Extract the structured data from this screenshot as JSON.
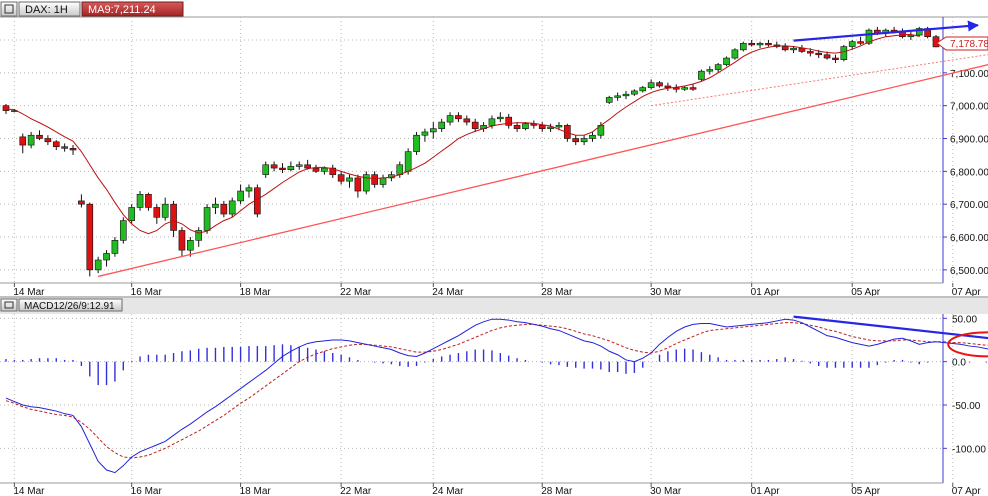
{
  "chart_data": [
    {
      "type": "candlestick",
      "instrument": "DAX",
      "timeframe": "1H",
      "header_symbol": "DAX: 1H",
      "header_indicator": "MA9:7,211.24",
      "last_price_label": "7,178.78",
      "y_ticks": [
        "7,200.00",
        "7,100.00",
        "7,000.00",
        "6,900.00",
        "6,800.00",
        "6,700.00",
        "6,600.00",
        "6,500.00"
      ],
      "y_tick_values": [
        7200,
        7100,
        7000,
        6900,
        6800,
        6700,
        6600,
        6500
      ],
      "ylim": [
        6460,
        7270
      ],
      "x_tick_labels": [
        "14 Mar",
        "16 Mar",
        "18 Mar",
        "22 Mar",
        "24 Mar",
        "28 Mar",
        "30 Mar",
        "01 Apr",
        "05 Apr",
        "07 Apr"
      ],
      "x_tick_index": [
        1,
        15,
        28,
        40,
        51,
        64,
        77,
        89,
        101,
        113
      ],
      "ma_period": 9,
      "candles": [
        [
          7000,
          7005,
          6975,
          6985
        ],
        [
          6985,
          6990,
          6980,
          6985
        ],
        [
          6905,
          6915,
          6855,
          6880
        ],
        [
          6880,
          6920,
          6870,
          6910
        ],
        [
          6910,
          6925,
          6895,
          6900
        ],
        [
          6900,
          6910,
          6880,
          6890
        ],
        [
          6890,
          6895,
          6865,
          6875
        ],
        [
          6875,
          6885,
          6860,
          6870
        ],
        [
          6870,
          6880,
          6850,
          6865
        ],
        [
          6710,
          6730,
          6690,
          6700
        ],
        [
          6700,
          6705,
          6480,
          6500
        ],
        [
          6500,
          6540,
          6490,
          6530
        ],
        [
          6530,
          6560,
          6510,
          6550
        ],
        [
          6550,
          6600,
          6540,
          6590
        ],
        [
          6590,
          6660,
          6580,
          6650
        ],
        [
          6650,
          6700,
          6640,
          6690
        ],
        [
          6690,
          6740,
          6680,
          6730
        ],
        [
          6730,
          6735,
          6680,
          6690
        ],
        [
          6690,
          6700,
          6640,
          6660
        ],
        [
          6660,
          6720,
          6650,
          6700
        ],
        [
          6700,
          6710,
          6600,
          6620
        ],
        [
          6620,
          6630,
          6540,
          6560
        ],
        [
          6560,
          6600,
          6540,
          6590
        ],
        [
          6590,
          6630,
          6570,
          6620
        ],
        [
          6620,
          6700,
          6610,
          6690
        ],
        [
          6690,
          6720,
          6670,
          6700
        ],
        [
          6700,
          6710,
          6660,
          6670
        ],
        [
          6670,
          6720,
          6660,
          6710
        ],
        [
          6710,
          6760,
          6700,
          6740
        ],
        [
          6740,
          6760,
          6720,
          6750
        ],
        [
          6750,
          6760,
          6660,
          6670
        ],
        [
          6790,
          6830,
          6780,
          6820
        ],
        [
          6820,
          6830,
          6800,
          6810
        ],
        [
          6810,
          6825,
          6795,
          6805
        ],
        [
          6805,
          6830,
          6800,
          6815
        ],
        [
          6815,
          6830,
          6805,
          6820
        ],
        [
          6820,
          6835,
          6805,
          6810
        ],
        [
          6810,
          6820,
          6795,
          6800
        ],
        [
          6800,
          6815,
          6790,
          6810
        ],
        [
          6810,
          6820,
          6780,
          6790
        ],
        [
          6790,
          6800,
          6760,
          6770
        ],
        [
          6770,
          6790,
          6750,
          6780
        ],
        [
          6780,
          6790,
          6720,
          6740
        ],
        [
          6740,
          6800,
          6730,
          6790
        ],
        [
          6790,
          6800,
          6750,
          6760
        ],
        [
          6760,
          6790,
          6750,
          6780
        ],
        [
          6780,
          6800,
          6770,
          6790
        ],
        [
          6790,
          6830,
          6780,
          6820
        ],
        [
          6800,
          6870,
          6790,
          6860
        ],
        [
          6860,
          6920,
          6850,
          6910
        ],
        [
          6910,
          6930,
          6890,
          6920
        ],
        [
          6920,
          6950,
          6900,
          6930
        ],
        [
          6930,
          6960,
          6920,
          6950
        ],
        [
          6950,
          6980,
          6940,
          6970
        ],
        [
          6970,
          6980,
          6950,
          6960
        ],
        [
          6960,
          6970,
          6940,
          6950
        ],
        [
          6950,
          6960,
          6920,
          6930
        ],
        [
          6930,
          6950,
          6920,
          6940
        ],
        [
          6940,
          6970,
          6930,
          6960
        ],
        [
          6960,
          6980,
          6950,
          6965
        ],
        [
          6965,
          6975,
          6930,
          6940
        ],
        [
          6940,
          6950,
          6920,
          6930
        ],
        [
          6930,
          6950,
          6925,
          6945
        ],
        [
          6945,
          6955,
          6930,
          6940
        ],
        [
          6940,
          6950,
          6920,
          6930
        ],
        [
          6930,
          6945,
          6920,
          6935
        ],
        [
          6935,
          6950,
          6925,
          6940
        ],
        [
          6940,
          6945,
          6890,
          6900
        ],
        [
          6900,
          6910,
          6880,
          6890
        ],
        [
          6890,
          6910,
          6880,
          6900
        ],
        [
          6900,
          6920,
          6890,
          6910
        ],
        [
          6910,
          6950,
          6900,
          6940
        ],
        [
          7010,
          7030,
          7005,
          7025
        ],
        [
          7025,
          7040,
          7015,
          7030
        ],
        [
          7030,
          7045,
          7020,
          7035
        ],
        [
          7035,
          7050,
          7030,
          7045
        ],
        [
          7045,
          7060,
          7040,
          7055
        ],
        [
          7055,
          7080,
          7050,
          7070
        ],
        [
          7070,
          7075,
          7055,
          7060
        ],
        [
          7060,
          7070,
          7045,
          7055
        ],
        [
          7055,
          7065,
          7040,
          7050
        ],
        [
          7050,
          7060,
          7045,
          7055
        ],
        [
          7055,
          7065,
          7045,
          7050
        ],
        [
          7080,
          7110,
          7075,
          7105
        ],
        [
          7105,
          7120,
          7095,
          7110
        ],
        [
          7110,
          7130,
          7100,
          7125
        ],
        [
          7125,
          7150,
          7120,
          7145
        ],
        [
          7145,
          7175,
          7140,
          7170
        ],
        [
          7170,
          7195,
          7165,
          7190
        ],
        [
          7190,
          7200,
          7180,
          7185
        ],
        [
          7185,
          7195,
          7175,
          7190
        ],
        [
          7190,
          7200,
          7180,
          7185
        ],
        [
          7185,
          7195,
          7175,
          7180
        ],
        [
          7180,
          7190,
          7165,
          7170
        ],
        [
          7170,
          7180,
          7160,
          7175
        ],
        [
          7175,
          7185,
          7160,
          7165
        ],
        [
          7165,
          7175,
          7150,
          7160
        ],
        [
          7160,
          7170,
          7145,
          7155
        ],
        [
          7155,
          7165,
          7140,
          7145
        ],
        [
          7145,
          7155,
          7130,
          7140
        ],
        [
          7140,
          7185,
          7135,
          7180
        ],
        [
          7180,
          7200,
          7170,
          7195
        ],
        [
          7195,
          7210,
          7185,
          7190
        ],
        [
          7190,
          7235,
          7185,
          7230
        ],
        [
          7230,
          7240,
          7215,
          7220
        ],
        [
          7220,
          7235,
          7210,
          7230
        ],
        [
          7230,
          7240,
          7220,
          7225
        ],
        [
          7225,
          7235,
          7205,
          7210
        ],
        [
          7210,
          7225,
          7200,
          7215
        ],
        [
          7215,
          7240,
          7210,
          7235
        ],
        [
          7235,
          7240,
          7205,
          7210
        ],
        [
          7210,
          7215,
          7178,
          7179
        ]
      ],
      "ma_values": [
        6990,
        6988,
        6975,
        6960,
        6948,
        6935,
        6920,
        6905,
        6892,
        6860,
        6820,
        6780,
        6745,
        6705,
        6668,
        6640,
        6620,
        6610,
        6620,
        6640,
        6650,
        6640,
        6622,
        6612,
        6618,
        6635,
        6650,
        6660,
        6680,
        6700,
        6715,
        6730,
        6748,
        6766,
        6782,
        6798,
        6808,
        6812,
        6812,
        6808,
        6800,
        6792,
        6785,
        6780,
        6778,
        6780,
        6782,
        6790,
        6800,
        6812,
        6825,
        6843,
        6862,
        6880,
        6900,
        6912,
        6922,
        6930,
        6938,
        6943,
        6946,
        6948,
        6948,
        6946,
        6942,
        6938,
        6928,
        6918,
        6910,
        6910,
        6920,
        6940,
        6958,
        6978,
        6996,
        7012,
        7028,
        7040,
        7048,
        7053,
        7056,
        7060,
        7066,
        7074,
        7085,
        7100,
        7116,
        7132,
        7150,
        7163,
        7172,
        7178,
        7182,
        7182,
        7180,
        7176,
        7172,
        7166,
        7162,
        7160,
        7164,
        7172,
        7182,
        7194,
        7203,
        7210,
        7213,
        7216,
        7217,
        7211
      ],
      "annotations": {
        "support_trendline": {
          "from_index": 11,
          "from_value": 6480,
          "to_index": 123,
          "to_value": 7160
        },
        "lower_dotted_line": {
          "from_index": 77,
          "from_value": 7000,
          "to_index": 123,
          "to_value": 7178
        },
        "price_high_arrow": {
          "from_index": 94,
          "from_value": 7198,
          "to_index": 116,
          "to_value": 7245
        }
      }
    },
    {
      "type": "macd",
      "header_indicator": "MACD12/26/9:12.91",
      "y_ticks": [
        "50.00",
        "0.0",
        "-50.00",
        "-100.00"
      ],
      "y_tick_values": [
        50,
        0,
        -50,
        -100
      ],
      "ylim": [
        -140,
        55
      ],
      "x_tick_labels": [
        "14 Mar",
        "16 Mar",
        "18 Mar",
        "22 Mar",
        "24 Mar",
        "28 Mar",
        "30 Mar",
        "01 Apr",
        "05 Apr",
        "07 Apr"
      ],
      "macd_line": [
        -42,
        -46,
        -50,
        -52,
        -53,
        -55,
        -57,
        -60,
        -62,
        -75,
        -95,
        -115,
        -125,
        -128,
        -120,
        -110,
        -104,
        -100,
        -96,
        -92,
        -85,
        -78,
        -72,
        -65,
        -58,
        -52,
        -45,
        -38,
        -31,
        -24,
        -17,
        -10,
        -2,
        6,
        12,
        17,
        21,
        23,
        24,
        25,
        25,
        24,
        22,
        20,
        18,
        16,
        14,
        10,
        7,
        6,
        10,
        15,
        20,
        25,
        30,
        36,
        42,
        46,
        49,
        49,
        48,
        46,
        45,
        43,
        41,
        38,
        36,
        32,
        28,
        24,
        22,
        18,
        12,
        8,
        2,
        0,
        4,
        10,
        20,
        28,
        35,
        40,
        43,
        44,
        44,
        42,
        40,
        41,
        42,
        43,
        44,
        45,
        47,
        49,
        48,
        45,
        40,
        35,
        30,
        28,
        25,
        22,
        20,
        18,
        20,
        23,
        26,
        27,
        24,
        20,
        22,
        23,
        22,
        21,
        20,
        18,
        17,
        15,
        13,
        12.9
      ],
      "signal_line": [
        -45,
        -48,
        -52,
        -55,
        -57,
        -59,
        -61,
        -62,
        -64,
        -70,
        -78,
        -88,
        -98,
        -105,
        -110,
        -111,
        -110,
        -108,
        -104,
        -100,
        -95,
        -90,
        -85,
        -80,
        -74,
        -68,
        -62,
        -55,
        -48,
        -42,
        -35,
        -28,
        -21,
        -14,
        -7,
        0,
        5,
        9,
        12,
        15,
        17,
        19,
        20,
        20,
        19,
        18,
        17,
        15,
        13,
        11,
        11,
        12,
        14,
        17,
        20,
        24,
        28,
        32,
        36,
        39,
        41,
        42,
        43,
        43,
        42,
        41,
        40,
        38,
        35,
        32,
        30,
        27,
        24,
        20,
        16,
        13,
        11,
        10,
        12,
        16,
        21,
        25,
        29,
        33,
        36,
        37,
        38,
        39,
        40,
        41,
        42,
        43,
        44,
        45,
        45,
        44,
        42,
        40,
        37,
        35,
        32,
        29,
        27,
        25,
        24,
        24,
        24,
        25,
        25,
        24,
        23,
        23,
        23,
        22,
        22,
        21,
        20,
        19,
        18,
        17,
        16,
        15
      ],
      "histogram": [
        3,
        2,
        2,
        3,
        4,
        4,
        4,
        2,
        2,
        -5,
        -17,
        -27,
        -27,
        -23,
        -10,
        1,
        6,
        8,
        8,
        8,
        10,
        12,
        13,
        15,
        16,
        16,
        17,
        17,
        17,
        18,
        18,
        18,
        19,
        20,
        19,
        17,
        16,
        14,
        12,
        10,
        8,
        5,
        2,
        0,
        -1,
        -2,
        -3,
        -5,
        -6,
        -5,
        -1,
        3,
        6,
        8,
        10,
        12,
        14,
        14,
        13,
        10,
        7,
        4,
        2,
        0,
        -1,
        -3,
        -4,
        -6,
        -7,
        -8,
        -8,
        -9,
        -12,
        -12,
        -14,
        -13,
        -7,
        0,
        8,
        12,
        14,
        15,
        14,
        11,
        8,
        5,
        2,
        2,
        2,
        2,
        2,
        2,
        3,
        5,
        3,
        1,
        -2,
        -5,
        -7,
        -7,
        -7,
        -7,
        -7,
        -7,
        -4,
        -1,
        2,
        2,
        -1,
        -3,
        -1,
        0,
        0,
        -1,
        -1,
        -1,
        0,
        -1,
        -1,
        -2,
        -2,
        -2
      ],
      "annotations": {
        "divergence_arrow": {
          "from_index": 94,
          "from_value": 52,
          "to_index": 124,
          "to_value": 20
        },
        "ellipse_center_index": 117,
        "ellipse_center_value": 20
      }
    }
  ]
}
